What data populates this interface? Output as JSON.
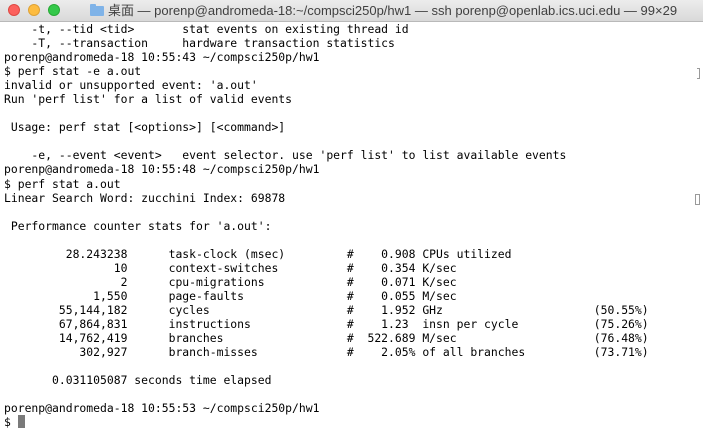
{
  "window": {
    "title": "桌面 — porenp@andromeda-18:~/compsci250p/hw1 — ssh porenp@openlab.ics.uci.edu — 99×29",
    "folder_icon": "folder-icon"
  },
  "terminal": {
    "lines": [
      "    -t, --tid <tid>       stat events on existing thread id",
      "    -T, --transaction     hardware transaction statistics",
      "porenp@andromeda-18 10:55:43 ~/compsci250p/hw1",
      "$ perf stat -e a.out",
      "invalid or unsupported event: 'a.out'",
      "Run 'perf list' for a list of valid events",
      "",
      " Usage: perf stat [<options>] [<command>]",
      "",
      "    -e, --event <event>   event selector. use 'perf list' to list available events",
      "porenp@andromeda-18 10:55:48 ~/compsci250p/hw1",
      "$ perf stat a.out",
      "Linear Search Word: zucchini Index: 69878",
      "",
      " Performance counter stats for 'a.out':",
      "",
      "         28.243238      task-clock (msec)         #    0.908 CPUs utilized",
      "                10      context-switches          #    0.354 K/sec",
      "                 2      cpu-migrations            #    0.071 K/sec",
      "             1,550      page-faults               #    0.055 M/sec",
      "        55,144,182      cycles                    #    1.952 GHz                      (50.55%)",
      "        67,864,831      instructions              #    1.23  insn per cycle           (75.26%)",
      "        14,762,419      branches                  #  522.689 M/sec                    (76.48%)",
      "           302,927      branch-misses             #    2.05% of all branches          (73.71%)",
      "",
      "       0.031105087 seconds time elapsed",
      "",
      "porenp@andromeda-18 10:55:53 ~/compsci250p/hw1",
      "$ "
    ]
  }
}
